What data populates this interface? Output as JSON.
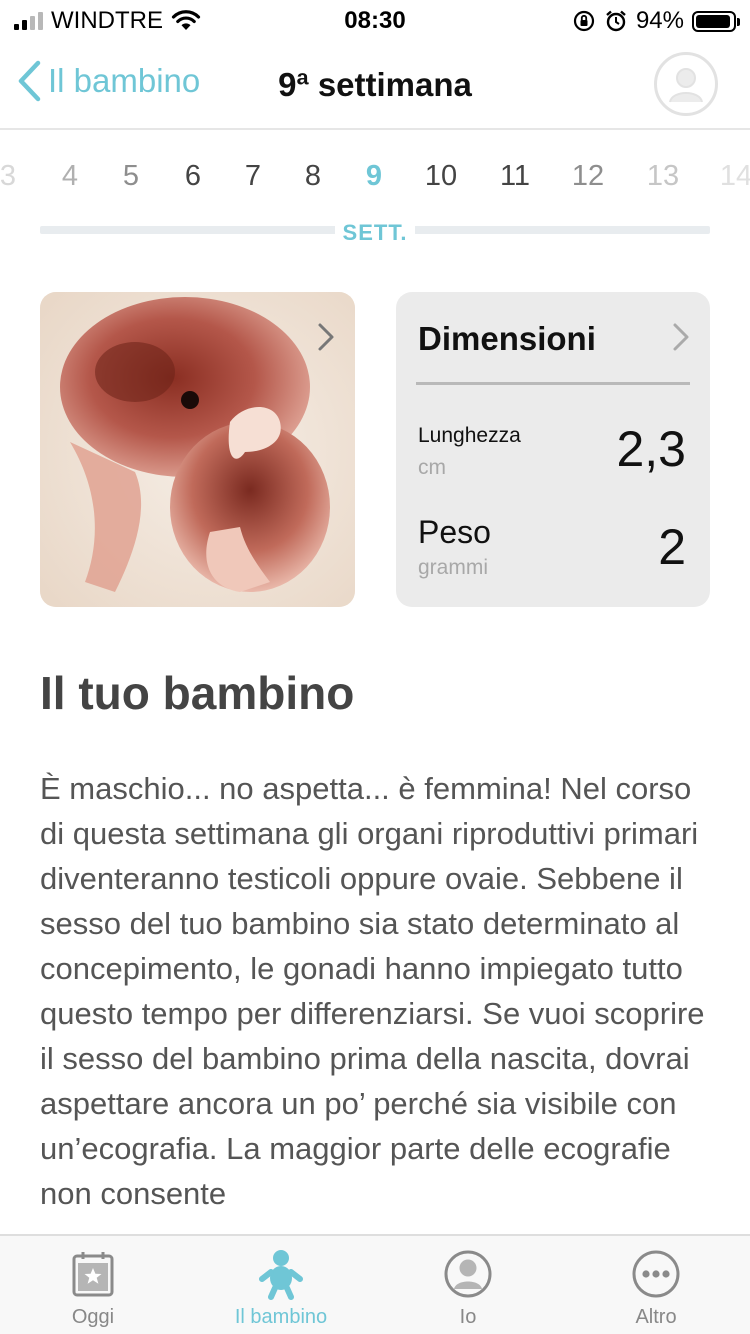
{
  "status_bar": {
    "carrier": "WINDTRE",
    "time": "08:30",
    "battery": "94%",
    "battery_level": 0.94
  },
  "nav": {
    "back_label": "Il bambino",
    "title": "9ª settimana"
  },
  "weeks": {
    "items": [
      "3",
      "4",
      "5",
      "6",
      "7",
      "8",
      "9",
      "10",
      "11",
      "12",
      "13",
      "14"
    ],
    "selected": "9",
    "unit_label": "SETT."
  },
  "dimensions": {
    "title": "Dimensioni",
    "length_label": "Lunghezza",
    "length_unit": "cm",
    "length_value": "2,3",
    "weight_label": "Peso",
    "weight_unit": "grammi",
    "weight_value": "2"
  },
  "article": {
    "heading": "Il tuo bambino",
    "body": "È maschio... no aspetta... è femmina! Nel corso di questa settimana gli organi riproduttivi primari diventeranno testicoli oppure ovaie. Sebbene il sesso del tuo bambino sia stato determinato al concepimento, le gonadi hanno impiegato tutto questo tempo per differenziarsi. Se vuoi scoprire il sesso del bambino prima della nascita, dovrai aspettare ancora un po’ perché sia visibile con un’ecografia. La maggior parte delle ecografie non consente"
  },
  "tabs": [
    {
      "label": "Oggi",
      "icon": "calendar-star-icon"
    },
    {
      "label": "Il bambino",
      "icon": "baby-icon",
      "active": true
    },
    {
      "label": "Io",
      "icon": "user-icon"
    },
    {
      "label": "Altro",
      "icon": "more-icon"
    }
  ],
  "colors": {
    "accent": "#6fc6d6",
    "card_bg": "#ebebeb",
    "text_muted": "#555555"
  }
}
